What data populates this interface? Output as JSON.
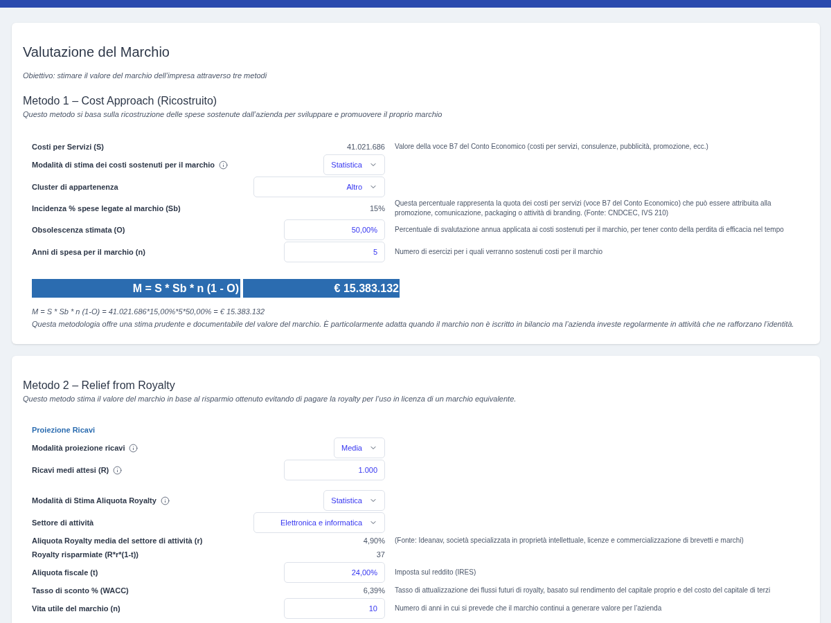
{
  "title": "Valutazione del Marchio",
  "objective": "Obiettivo: stimare il valore del marchio dell’impresa attraverso tre metodi",
  "methods": [
    {
      "title": "Metodo 1 – Cost Approach (Ricostruito)",
      "description": "Questo metodo si basa sulla ricostruzione delle spese sostenute dall’azienda per sviluppare e promuovere il proprio marchio",
      "groups": [
        {
          "rows": [
            {
              "kind": "readout",
              "label": "Costi per Servizi (S)",
              "info": false,
              "value": "41.021.686",
              "description": "Valore della voce B7 del Conto Economico (costi per servizi, consulenze, pubblicità, promozione, ecc.)"
            },
            {
              "kind": "select",
              "label": "Modalità di stima dei costi sostenuti per il marchio",
              "info": true,
              "value": "Statistica"
            },
            {
              "kind": "category_select",
              "label": "Cluster di appartenenza",
              "info": false,
              "value": "Altro"
            },
            {
              "kind": "readout",
              "label": "Incidenza % spese legate al marchio (Sb)",
              "info": false,
              "value": "15%",
              "description": "Questa percentuale rappresenta la quota dei costi per servizi (voce B7 del Conto Economico) che può essere attribuita alla promozione, comunicazione, packaging o attività di branding. (Fonte: CNDCEC, IVS 210)"
            },
            {
              "kind": "input",
              "label": "Obsolescenza stimata (O)",
              "info": false,
              "value": "50,00%",
              "description": "Percentuale di svalutazione annua applicata ai costi sostenuti per il marchio, per tener conto della perdita di efficacia nel tempo"
            },
            {
              "kind": "input",
              "label": "Anni di spesa per il marchio (n)",
              "info": false,
              "value": "5",
              "description": "Numero di esercizi per i quali verranno sostenuti costi per il marchio"
            }
          ]
        }
      ],
      "result": {
        "formula": "M = S * Sb * n (1 - O)",
        "value": "€ 15.383.132"
      },
      "calculation": "M = S * Sb * n (1-O) = 41.021.686*15,00%*5*50,00% = € 15.383.132",
      "note": "Questa metodologia offre una stima prudente e documentabile del valore del marchio. È particolarmente adatta quando il marchio non è iscritto in bilancio ma l’azienda investe regolarmente in attività che ne rafforzano l’identità."
    },
    {
      "title": "Metodo 2 – Relief from Royalty",
      "description": "Questo metodo stima il valore del marchio in base al risparmio ottenuto evitando di pagare la royalty per l’uso in licenza di un marchio equivalente.",
      "groups": [
        {
          "title": "Proiezione Ricavi",
          "rows": [
            {
              "kind": "select",
              "label": "Modalità proiezione ricavi",
              "info": true,
              "value": "Media"
            },
            {
              "kind": "input",
              "label": "Ricavi medi attesi (R)",
              "info": true,
              "value": "1.000"
            }
          ]
        },
        {
          "rows": [
            {
              "kind": "select",
              "label": "Modalità di Stima Aliquota Royalty",
              "info": true,
              "value": "Statistica"
            },
            {
              "kind": "category_select",
              "label": "Settore di attività",
              "info": false,
              "value": "Elettronica e informatica"
            },
            {
              "kind": "readout",
              "label": "Aliquota Royalty media del settore di attività (r)",
              "info": false,
              "value": "4,90%",
              "description": "(Fonte: Ideanav, società specializzata in proprietà intellettuale, licenze e commercializzazione di brevetti e marchi)"
            },
            {
              "kind": "readout",
              "label": "Royalty risparmiate (R*r*(1-t))",
              "info": false,
              "value": "37"
            },
            {
              "kind": "input",
              "label": "Aliquota fiscale (t)",
              "info": false,
              "value": "24,00%",
              "description": "Imposta sul reddito (IRES)"
            },
            {
              "kind": "readout",
              "label": "Tasso di sconto % (WACC)",
              "info": false,
              "value": "6,39%",
              "description": "Tasso di attualizzazione dei flussi futuri di royalty, basato sul rendimento del capitale proprio e del costo del capitale di terzi"
            },
            {
              "kind": "input",
              "label": "Vita utile del marchio (n)",
              "info": false,
              "value": "10",
              "description": "Numero di anni in cui si prevede che il marchio continui a generare valore per l’azienda"
            }
          ]
        }
      ]
    }
  ]
}
